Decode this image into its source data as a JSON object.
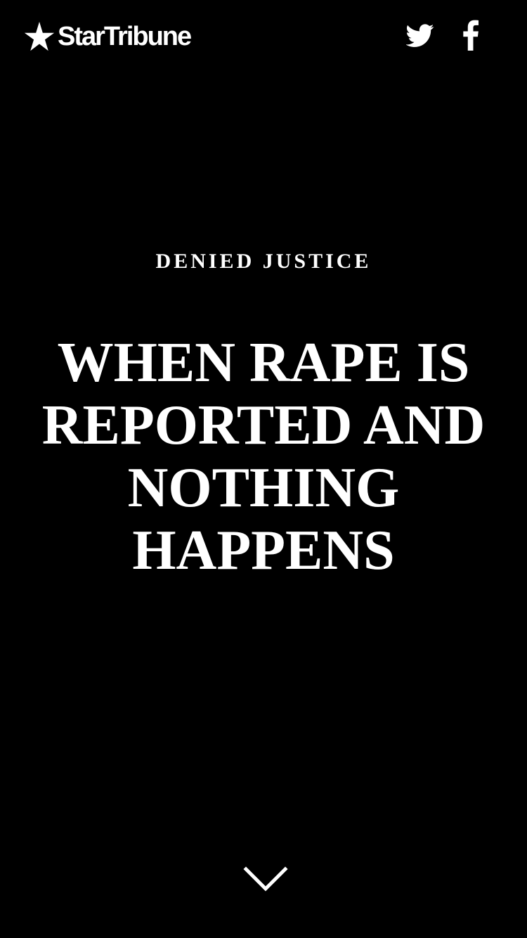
{
  "header": {
    "logo_text": "StarTribune",
    "logo_icon": "star-icon",
    "social": [
      {
        "icon": "twitter-icon"
      },
      {
        "icon": "facebook-icon"
      }
    ]
  },
  "hero": {
    "kicker": "DENIED JUSTICE",
    "headline": "WHEN RAPE IS REPORTED AND NOTHING HAPPENS"
  },
  "scroll_indicator": {
    "icon": "chevron-down-icon"
  },
  "colors": {
    "background": "#000000",
    "text": "#ffffff"
  }
}
